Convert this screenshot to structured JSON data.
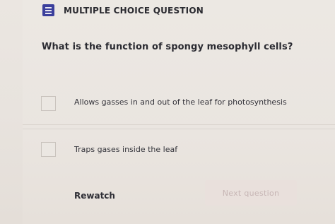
{
  "header": {
    "label": "MULTIPLE CHOICE QUESTION",
    "icon": "question-list-icon",
    "icon_color": "#3b3f9c"
  },
  "question": {
    "text": "What is the function of spongy mesophyll cells?"
  },
  "options": [
    {
      "text": "Allows gasses in and out of the leaf for photosynthesis",
      "checked": false
    },
    {
      "text": "Traps gases inside the leaf",
      "checked": false
    }
  ],
  "footer": {
    "rewatch_label": "Rewatch",
    "next_label": "Next question",
    "next_enabled": false
  }
}
